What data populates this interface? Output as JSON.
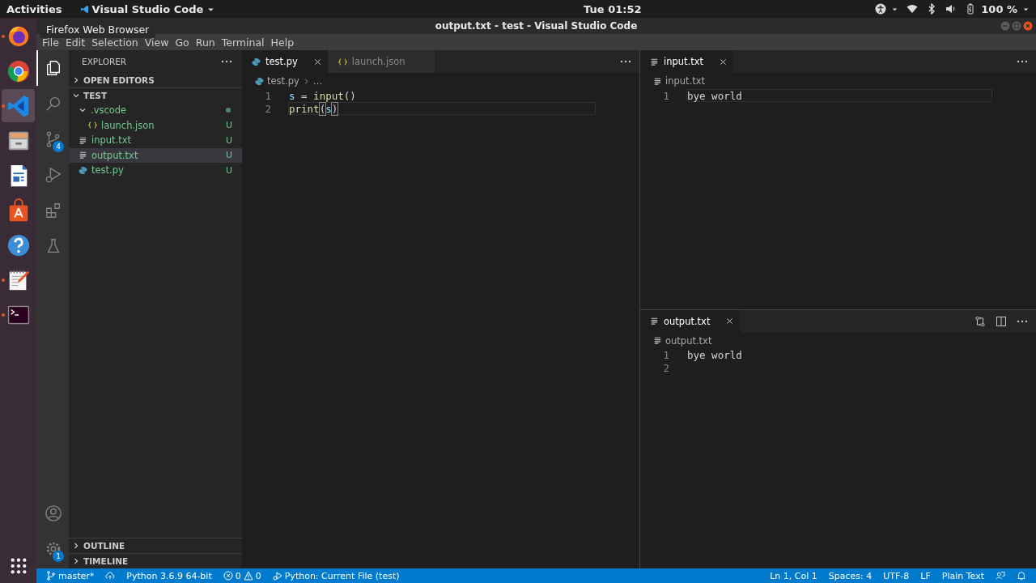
{
  "top_bar": {
    "activities": "Activities",
    "app_menu": "Visual Studio Code",
    "clock": "Tue 01:52",
    "battery": "100 %"
  },
  "dock": {
    "apps": [
      {
        "kind": "firefox",
        "running": true,
        "selected": false
      },
      {
        "kind": "chrome",
        "running": false,
        "selected": false
      },
      {
        "kind": "vscode",
        "running": true,
        "selected": true
      },
      {
        "kind": "files",
        "running": false,
        "selected": false
      },
      {
        "kind": "writer",
        "running": false,
        "selected": false
      },
      {
        "kind": "software",
        "running": false,
        "selected": false
      },
      {
        "kind": "help",
        "running": false,
        "selected": false
      },
      {
        "kind": "text-editor",
        "running": true,
        "selected": false
      },
      {
        "kind": "terminal",
        "running": true,
        "selected": false
      }
    ],
    "tooltip": "Firefox Web Browser"
  },
  "window": {
    "title": "output.txt - test - Visual Studio Code"
  },
  "menu": [
    "File",
    "Edit",
    "Selection",
    "View",
    "Go",
    "Run",
    "Terminal",
    "Help"
  ],
  "activity_bar": {
    "items": [
      {
        "kind": "explorer",
        "selected": true
      },
      {
        "kind": "search",
        "selected": false
      },
      {
        "kind": "source-control",
        "selected": false,
        "badge": "4"
      },
      {
        "kind": "run",
        "selected": false
      },
      {
        "kind": "extensions",
        "selected": false
      },
      {
        "kind": "testing",
        "selected": false
      }
    ],
    "bottom": [
      {
        "kind": "account"
      },
      {
        "kind": "manage",
        "badge": "1"
      }
    ]
  },
  "sidebar": {
    "title": "EXPLORER",
    "sections": [
      {
        "title": "OPEN EDITORS",
        "expanded": false
      },
      {
        "title": "TEST",
        "expanded": true
      }
    ],
    "tree": [
      {
        "name": ".vscode",
        "kind": "folder",
        "expanded": true,
        "selected": false,
        "changed": true,
        "children": [
          {
            "name": "launch.json",
            "kind": "json",
            "selected": false,
            "status": "U"
          }
        ]
      },
      {
        "name": "input.txt",
        "kind": "text",
        "selected": false,
        "status": "U"
      },
      {
        "name": "output.txt",
        "kind": "text",
        "selected": true,
        "status": "U"
      },
      {
        "name": "test.py",
        "kind": "python",
        "selected": false,
        "status": "U"
      }
    ],
    "bottom_sections": [
      {
        "title": "OUTLINE",
        "expanded": false
      },
      {
        "title": "TIMELINE",
        "expanded": false
      }
    ]
  },
  "editor_groups": [
    {
      "tabs": [
        {
          "label": "test.py",
          "kind": "python",
          "selected": true
        },
        {
          "label": "launch.json",
          "kind": "json",
          "selected": false
        }
      ],
      "breadcrumb": {
        "file": "test.py",
        "kind": "python",
        "rest": "…"
      },
      "lines": [
        {
          "number": "1",
          "current": false,
          "tokens": [
            {
              "text": "s",
              "kind": "variable"
            },
            {
              "text": " = ",
              "kind": "plain"
            },
            {
              "text": "input",
              "kind": "function"
            },
            {
              "text": "()",
              "kind": "plain"
            }
          ]
        },
        {
          "number": "2",
          "current": true,
          "tokens": [
            {
              "text": "print",
              "kind": "function"
            },
            {
              "text": "(",
              "kind": "bracket"
            },
            {
              "text": "s",
              "kind": "variable"
            },
            {
              "text": ")",
              "kind": "bracket"
            }
          ]
        }
      ]
    },
    {
      "tabs": [
        {
          "label": "input.txt",
          "kind": "text",
          "selected": true
        }
      ],
      "breadcrumb": {
        "file": "input.txt",
        "kind": "text"
      },
      "lines": [
        {
          "number": "1",
          "current": true,
          "tokens": [
            {
              "text": "bye world",
              "kind": "plain"
            }
          ]
        }
      ]
    },
    {
      "tabs": [
        {
          "label": "output.txt",
          "kind": "text",
          "selected": true
        }
      ],
      "breadcrumb": {
        "file": "output.txt",
        "kind": "text"
      },
      "lines": [
        {
          "number": "1",
          "current": false,
          "tokens": [
            {
              "text": "bye world",
              "kind": "plain"
            }
          ]
        },
        {
          "number": "2",
          "current": false
        }
      ]
    }
  ],
  "status_bar": {
    "left": [
      {
        "kind": "branch",
        "text": "master*"
      },
      {
        "kind": "sync"
      },
      {
        "kind": "text",
        "text": "Python 3.6.9 64-bit"
      },
      {
        "kind": "problems",
        "errors": "0",
        "warnings": "0"
      },
      {
        "kind": "debug",
        "text": "Python: Current File (test)"
      }
    ],
    "right": [
      {
        "kind": "text",
        "text": "Ln 1, Col 1"
      },
      {
        "kind": "text",
        "text": "Spaces: 4"
      },
      {
        "kind": "text",
        "text": "UTF-8"
      },
      {
        "kind": "text",
        "text": "LF"
      },
      {
        "kind": "text",
        "text": "Plain Text"
      },
      {
        "kind": "feedback"
      },
      {
        "kind": "bell"
      }
    ]
  }
}
